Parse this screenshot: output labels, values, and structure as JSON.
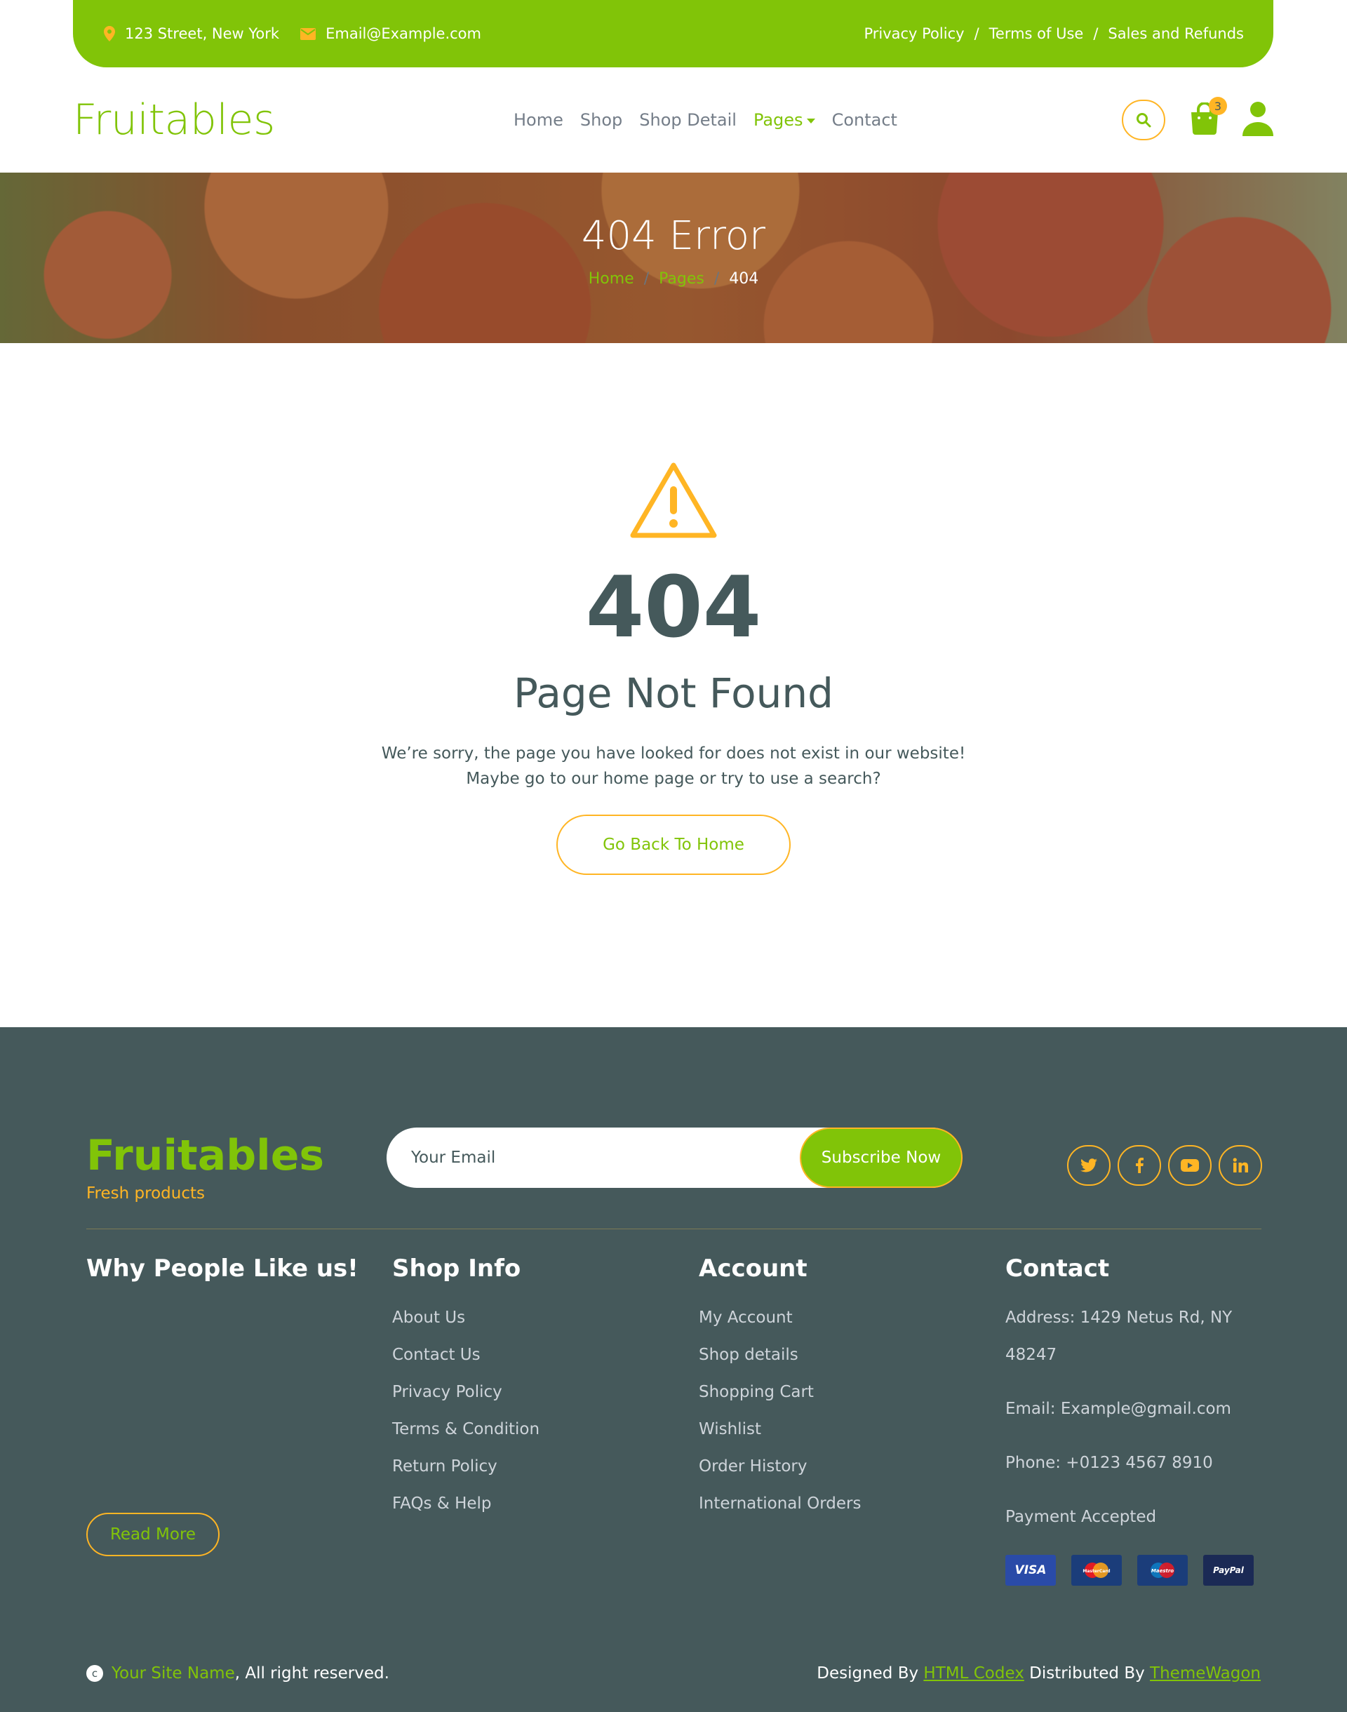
{
  "topbar": {
    "address": "123 Street, New York",
    "email": "Email@Example.com",
    "links": [
      "Privacy Policy",
      "Terms of Use",
      "Sales and Refunds"
    ],
    "separator": "/"
  },
  "navbar": {
    "brand": "Fruitables",
    "links": [
      "Home",
      "Shop",
      "Shop Detail",
      "Pages",
      "Contact"
    ],
    "cart_count": "3"
  },
  "hero": {
    "title": "404 Error",
    "breadcrumb": [
      "Home",
      "Pages",
      "404"
    ],
    "separator": "/"
  },
  "error": {
    "code": "404",
    "title": "Page Not Found",
    "message_line1": "We’re sorry, the page you have looked for does not exist in our website!",
    "message_line2": "Maybe go to our home page or try to use a search?",
    "button": "Go Back To Home"
  },
  "footer": {
    "brand": "Fruitables",
    "tagline": "Fresh products",
    "newsletter": {
      "placeholder": "Your Email",
      "button": "Subscribe Now"
    },
    "col1": {
      "title": "Why People Like us!",
      "button": "Read More"
    },
    "col2": {
      "title": "Shop Info",
      "links": [
        "About Us",
        "Contact Us",
        "Privacy Policy",
        "Terms & Condition",
        "Return Policy",
        "FAQs & Help"
      ]
    },
    "col3": {
      "title": "Account",
      "links": [
        "My Account",
        "Shop details",
        "Shopping Cart",
        "Wishlist",
        "Order History",
        "International Orders"
      ]
    },
    "col4": {
      "title": "Contact",
      "address_line1": "Address: 1429 Netus Rd, NY",
      "address_line2": "48247",
      "email": "Email: Example@gmail.com",
      "phone": "Phone: +0123 4567 8910",
      "payment_label": "Payment Accepted",
      "payments": [
        "VISA",
        "MasterCard",
        "Maestro",
        "PayPal"
      ]
    },
    "copyright_symbol": "c",
    "site_name": "Your Site Name",
    "rights": ", All right reserved.",
    "designed_by": "Designed By ",
    "designer": "HTML Codex",
    "distributed_by": " Distributed By ",
    "distributor": "ThemeWagon"
  },
  "colors": {
    "primary": "#81c408",
    "secondary": "#ffb524",
    "dark": "#45595b"
  },
  "icons": [
    "map-marker-icon",
    "envelope-icon",
    "search-icon",
    "shopping-bag-icon",
    "user-icon",
    "warning-icon",
    "twitter-icon",
    "facebook-icon",
    "youtube-icon",
    "linkedin-icon",
    "copyright-icon"
  ]
}
